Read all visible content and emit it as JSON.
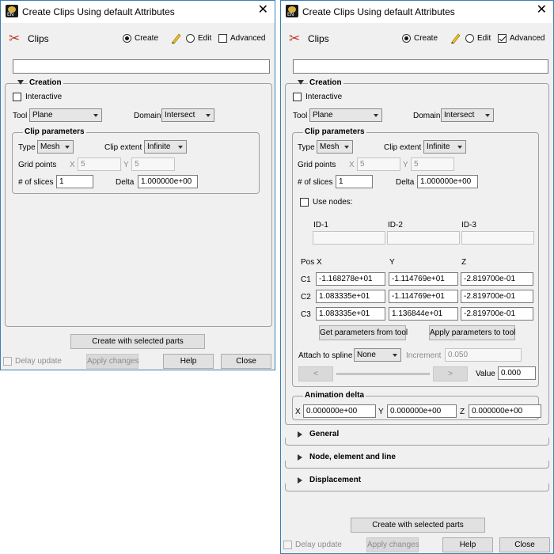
{
  "window_title": "Create Clips Using default Attributes",
  "close_glyph": "✕",
  "header": {
    "label": "Clips",
    "create_label": "Create",
    "edit_label": "Edit",
    "advanced_label": "Advanced"
  },
  "creation": {
    "title": "Creation",
    "interactive_label": "Interactive",
    "tool_label": "Tool",
    "tool_value": "Plane",
    "domain_label": "Domain",
    "domain_value": "Intersect"
  },
  "clip_params": {
    "title": "Clip parameters",
    "type_label": "Type",
    "type_value": "Mesh",
    "clip_extent_label": "Clip extent",
    "clip_extent_value": "Infinite",
    "grid_points_label": "Grid points",
    "x_label": "X",
    "x_value": "5",
    "y_label": "Y",
    "y_value": "5",
    "slices_label": "# of slices",
    "slices_value": "1",
    "delta_label": "Delta",
    "delta_value": "1.000000e+00"
  },
  "advanced": {
    "use_nodes_label": "Use nodes:",
    "id_headers": [
      "ID-1",
      "ID-2",
      "ID-3"
    ],
    "pos_label": "Pos",
    "col_headers": [
      "X",
      "Y",
      "Z"
    ],
    "rows": [
      {
        "label": "C1",
        "values": [
          "-1.168278e+01",
          "-1.114769e+01",
          "-2.819700e-01"
        ]
      },
      {
        "label": "C2",
        "values": [
          "1.083335e+01",
          "-1.114769e+01",
          "-2.819700e-01"
        ]
      },
      {
        "label": "C3",
        "values": [
          "1.083335e+01",
          "1.136844e+01",
          "-2.819700e-01"
        ]
      }
    ],
    "get_params_label": "Get parameters from tool",
    "apply_params_label": "Apply parameters to tool",
    "attach_label": "Attach to spline",
    "attach_value": "None",
    "increment_label": "Increment",
    "increment_value": "0.050",
    "prev_glyph": "<",
    "next_glyph": ">",
    "value_label": "Value",
    "value_value": "0.000"
  },
  "animation_delta": {
    "title": "Animation delta",
    "x_label": "X",
    "x_value": "0.000000e+00",
    "y_label": "Y",
    "y_value": "0.000000e+00",
    "z_label": "Z",
    "z_value": "0.000000e+00"
  },
  "sections": {
    "general": "General",
    "node_element_line": "Node, element and line",
    "displacement": "Displacement"
  },
  "footer": {
    "create_selected_label": "Create with selected parts",
    "delay_update_label": "Delay update",
    "apply_changes_label": "Apply changes",
    "help_label": "Help",
    "close_label": "Close"
  }
}
